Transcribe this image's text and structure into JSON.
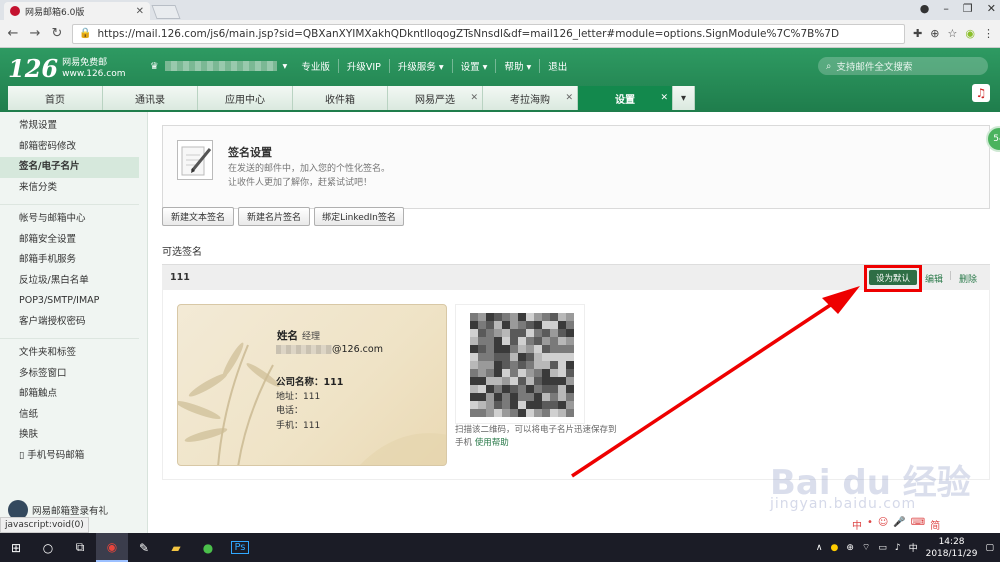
{
  "browser": {
    "tab_title": "网易邮箱6.0版",
    "url": "https://mail.126.com/js6/main.jsp?sid=QBXanXYIMXakhQDkntlloqogZTsNnsdl&df=mail126_letter#module=options.SignModule%7C%7B%7D",
    "status": "javascript:void(0)"
  },
  "header": {
    "logo_num": "126",
    "logo_line1": "网易免费邮",
    "logo_line2": "www.126.com",
    "menu": [
      "专业版",
      "升级VIP",
      "升级服务 ▾",
      "设置 ▾",
      "帮助 ▾",
      "退出"
    ],
    "search_placeholder": "支持邮件全文搜索"
  },
  "navtabs": [
    {
      "label": "首页",
      "closable": false
    },
    {
      "label": "通讯录",
      "closable": false
    },
    {
      "label": "应用中心",
      "closable": false
    },
    {
      "label": "收件箱",
      "closable": false
    },
    {
      "label": "网易严选",
      "closable": true
    },
    {
      "label": "考拉海购",
      "closable": true
    },
    {
      "label": "设置",
      "closable": true,
      "active": true
    }
  ],
  "sidebar": {
    "groups": [
      [
        "常规设置",
        "邮箱密码修改",
        "签名/电子名片",
        "来信分类"
      ],
      [
        "帐号与邮箱中心",
        "邮箱安全设置",
        "邮箱手机服务",
        "反垃圾/黑白名单",
        "POP3/SMTP/IMAP",
        "客户端授权密码"
      ],
      [
        "文件夹和标签",
        "多标签窗口",
        "邮箱触点",
        "信纸",
        "换肤",
        "▯ 手机号码邮箱"
      ]
    ],
    "active": "签名/电子名片",
    "promo": "网易邮箱登录有礼"
  },
  "signature_settings": {
    "title": "签名设置",
    "desc1": "在发送的邮件中，加入您的个性化签名。",
    "desc2": "让收件人更加了解你，赶紧试试吧！",
    "buttons": [
      "新建文本签名",
      "新建名片签名",
      "绑定LinkedIn签名"
    ],
    "optional_title": "可选签名",
    "signature_name": "111",
    "set_default": "设为默认",
    "edit": "编辑",
    "separator": "|",
    "delete": "删除"
  },
  "card": {
    "name": "姓名",
    "role": "经理",
    "email_suffix": "@126.com",
    "company": "公司名称：111",
    "address": "地址：111",
    "phone": "电话：",
    "mobile": "手机：111"
  },
  "qr": {
    "text": "扫描该二维码，可以将电子名片迅速保存到手机",
    "help": "使用帮助"
  },
  "side_badge": "54",
  "watermark": "Bai du 经验",
  "watermark_sub": "jingyan.baidu.com",
  "ime": [
    "中",
    "•",
    "☺",
    "🎤",
    "⌨",
    "简"
  ],
  "taskbar": {
    "time": "14:28",
    "date": "2018/11/29"
  },
  "colors": {
    "brand_green": "#1f7d4c",
    "active_tab": "#13894d",
    "highlight_red": "#e00000",
    "arrow_red": "#e00000"
  }
}
